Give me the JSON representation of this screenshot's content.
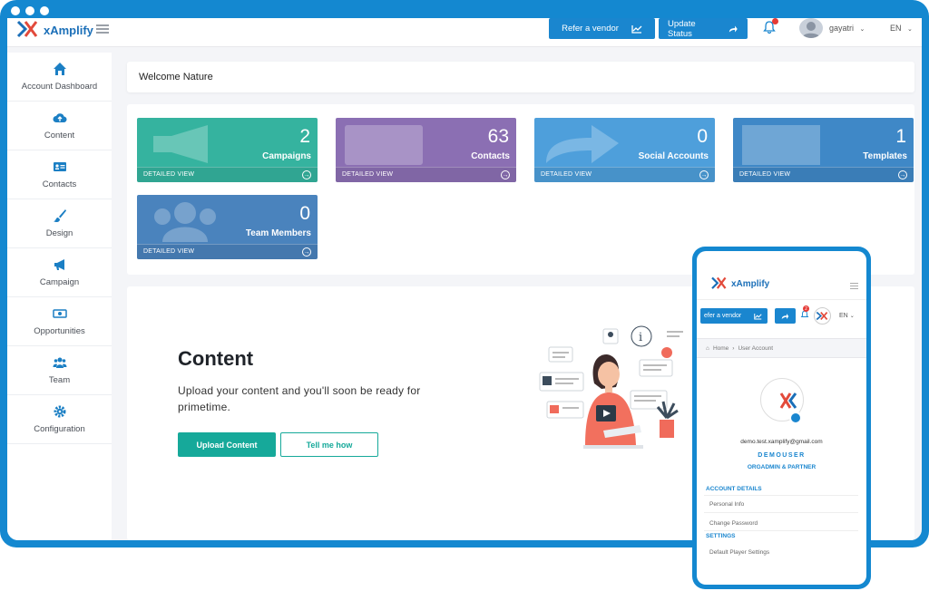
{
  "app": {
    "brand": "xAmplify",
    "brand_mobile": "xAmplify"
  },
  "header": {
    "refer_vendor": "Refer a vendor",
    "update_status": "Update Status",
    "user_name": "gayatri",
    "language": "EN"
  },
  "sidebar": {
    "items": [
      {
        "label": "Account Dashboard",
        "icon": "home-icon"
      },
      {
        "label": "Content",
        "icon": "cloud-upload-icon"
      },
      {
        "label": "Contacts",
        "icon": "address-card-icon"
      },
      {
        "label": "Design",
        "icon": "paint-brush-icon"
      },
      {
        "label": "Campaign",
        "icon": "megaphone-icon"
      },
      {
        "label": "Opportunities",
        "icon": "money-bill-icon"
      },
      {
        "label": "Team",
        "icon": "users-icon"
      },
      {
        "label": "Configuration",
        "icon": "gear-icon"
      }
    ]
  },
  "welcome": {
    "text": "Welcome Nature"
  },
  "stats": [
    {
      "value": "2",
      "label": "Campaigns",
      "footer": "DETAILED VIEW",
      "color": "#35b39f"
    },
    {
      "value": "63",
      "label": "Contacts",
      "footer": "DETAILED VIEW",
      "color": "#8b6fb3"
    },
    {
      "value": "0",
      "label": "Social Accounts",
      "footer": "DETAILED VIEW",
      "color": "#4e9fdb"
    },
    {
      "value": "1",
      "label": "Templates",
      "footer": "DETAILED VIEW",
      "color": "#3f88c7"
    },
    {
      "value": "0",
      "label": "Team Members",
      "footer": "DETAILED VIEW",
      "color": "#4a83bd"
    }
  ],
  "content_section": {
    "title": "Content",
    "description": "Upload your content and you'll soon be ready for primetime.",
    "upload_button": "Upload Content",
    "tell_button": "Tell me how"
  },
  "mobile": {
    "refer_vendor": "efer a vendor",
    "notification_count": "2",
    "language": "EN",
    "breadcrumb_home": "Home",
    "breadcrumb_separator": "›",
    "breadcrumb_current": "User Account",
    "email": "demo.test.xamplify@gmail.com",
    "username": "DEMOUSER",
    "role": "ORGADMIN & PARTNER",
    "account_details": "ACCOUNT DETAILS",
    "personal_info": "Personal Info",
    "change_password": "Change Password",
    "settings": "SETTINGS",
    "default_player": "Default Player Settings"
  },
  "colors": {
    "primary": "#1a86cf",
    "teal": "#16a99a",
    "frame": "#1488d0"
  }
}
